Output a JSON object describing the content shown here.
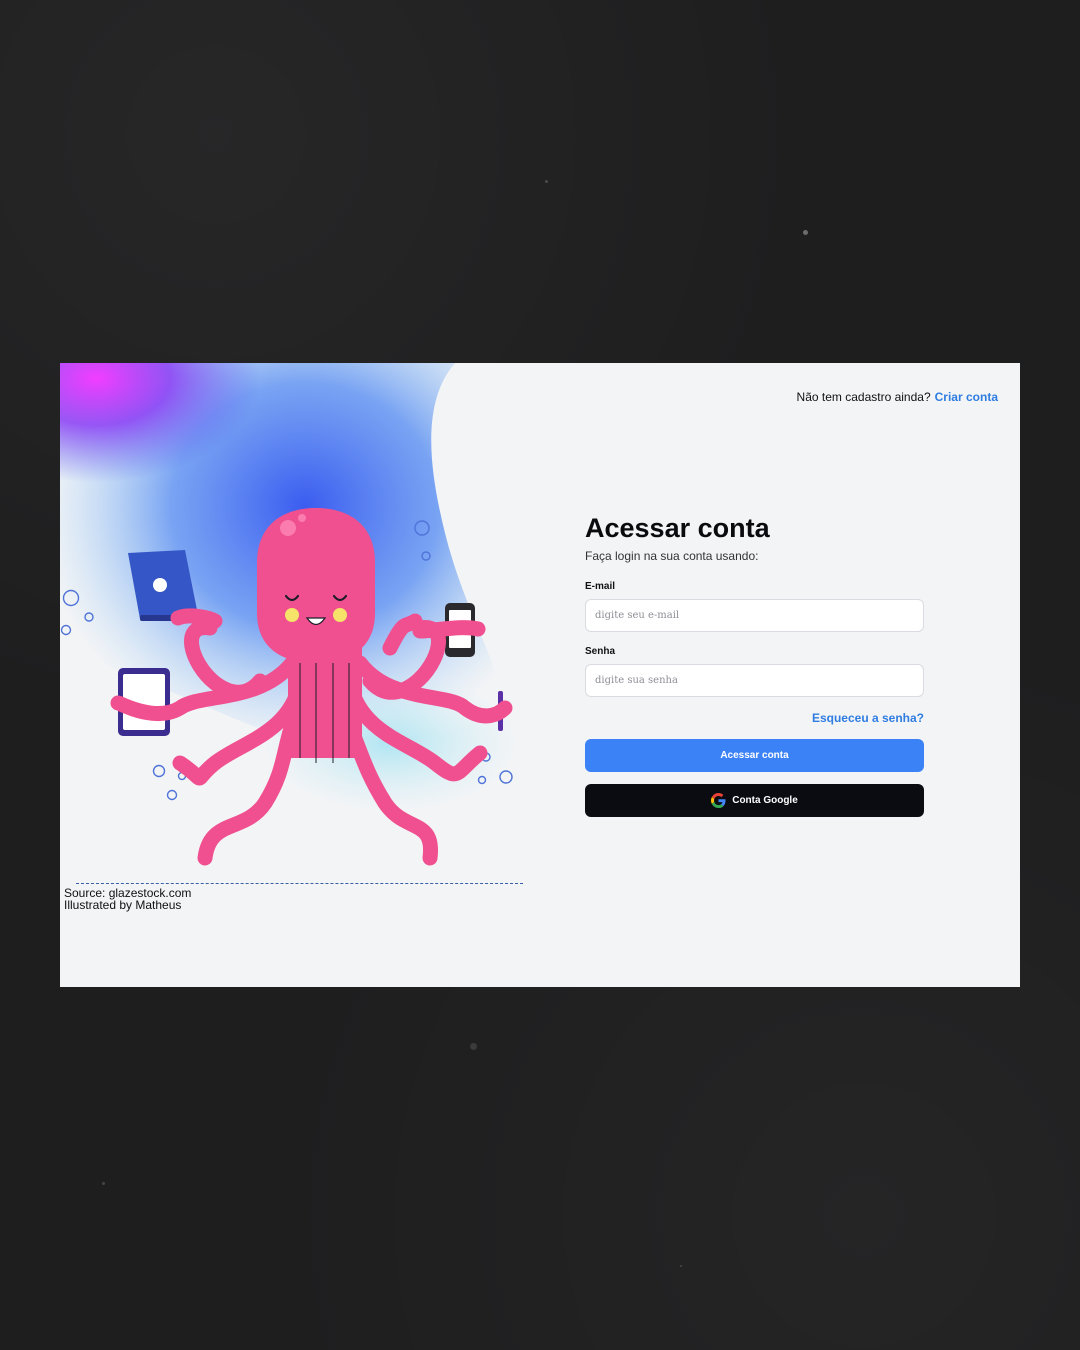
{
  "header": {
    "signup_prompt": "Não tem cadastro ainda?",
    "signup_link": "Criar conta"
  },
  "form": {
    "title": "Acessar conta",
    "subtitle": "Faça login na sua conta usando:",
    "email_label": "E-mail",
    "email_placeholder": "digite seu e-mail",
    "email_value": "",
    "password_label": "Senha",
    "password_placeholder": "digite sua senha",
    "password_value": "",
    "forgot_link": "Esqueceu a senha?",
    "submit_label": "Acessar conta",
    "google_label": "Conta Google"
  },
  "credits": {
    "source": "Source: glazestock.com",
    "illustrator": "Illustrated by Matheus"
  },
  "icons": {
    "google": "google-g-icon",
    "illustration": "octopus-multitasking-illustration"
  },
  "colors": {
    "accent": "#3b82f6",
    "link": "#2f7de1",
    "dark_button": "#0a0c12",
    "octopus": "#f0508f",
    "card_bg": "#f3f4f6",
    "page_bg": "#1e1e1f"
  }
}
